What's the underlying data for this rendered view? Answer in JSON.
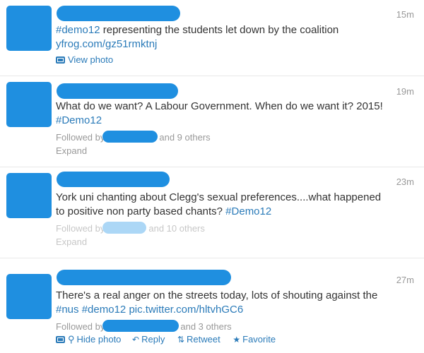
{
  "colors": {
    "avatar": "#1f8fe0",
    "redaction": "#1f8fe0",
    "redaction_light": "#6ab8ef",
    "link": "#2b7bb9",
    "muted": "#999999"
  },
  "tweets": [
    {
      "time": "15m",
      "text_parts": [
        "#demo12",
        " representing the students let down by the coalition"
      ],
      "link_line": "yfrog.com/gz51rmktnj",
      "view_photo": "View photo"
    },
    {
      "time": "19m",
      "line1": "What do we want? A Labour Government. When do we want it? 2015!",
      "hashtag": "#Demo12",
      "followed_by": "Followed by",
      "others": "and 9 others",
      "expand": "Expand"
    },
    {
      "time": "23m",
      "line1": "York uni chanting about Clegg's sexual preferences....what happened",
      "line2_text": "to positive non party based chants?",
      "hashtag": "#Demo12",
      "followed_by": "Followed by",
      "others": "and 10 others",
      "expand": "Expand"
    },
    {
      "time": "27m",
      "line1": "There's a real anger on the streets today, lots of shouting against the",
      "hashtag1": "#nus",
      "hashtag2": "#demo12",
      "pic_link": "pic.twitter.com/hltvhGC6",
      "followed_by": "Followed by",
      "others": "and 3 others",
      "hide_photo": "Hide photo",
      "reply": "Reply",
      "retweet": "Retweet",
      "favorite": "Favorite"
    }
  ]
}
